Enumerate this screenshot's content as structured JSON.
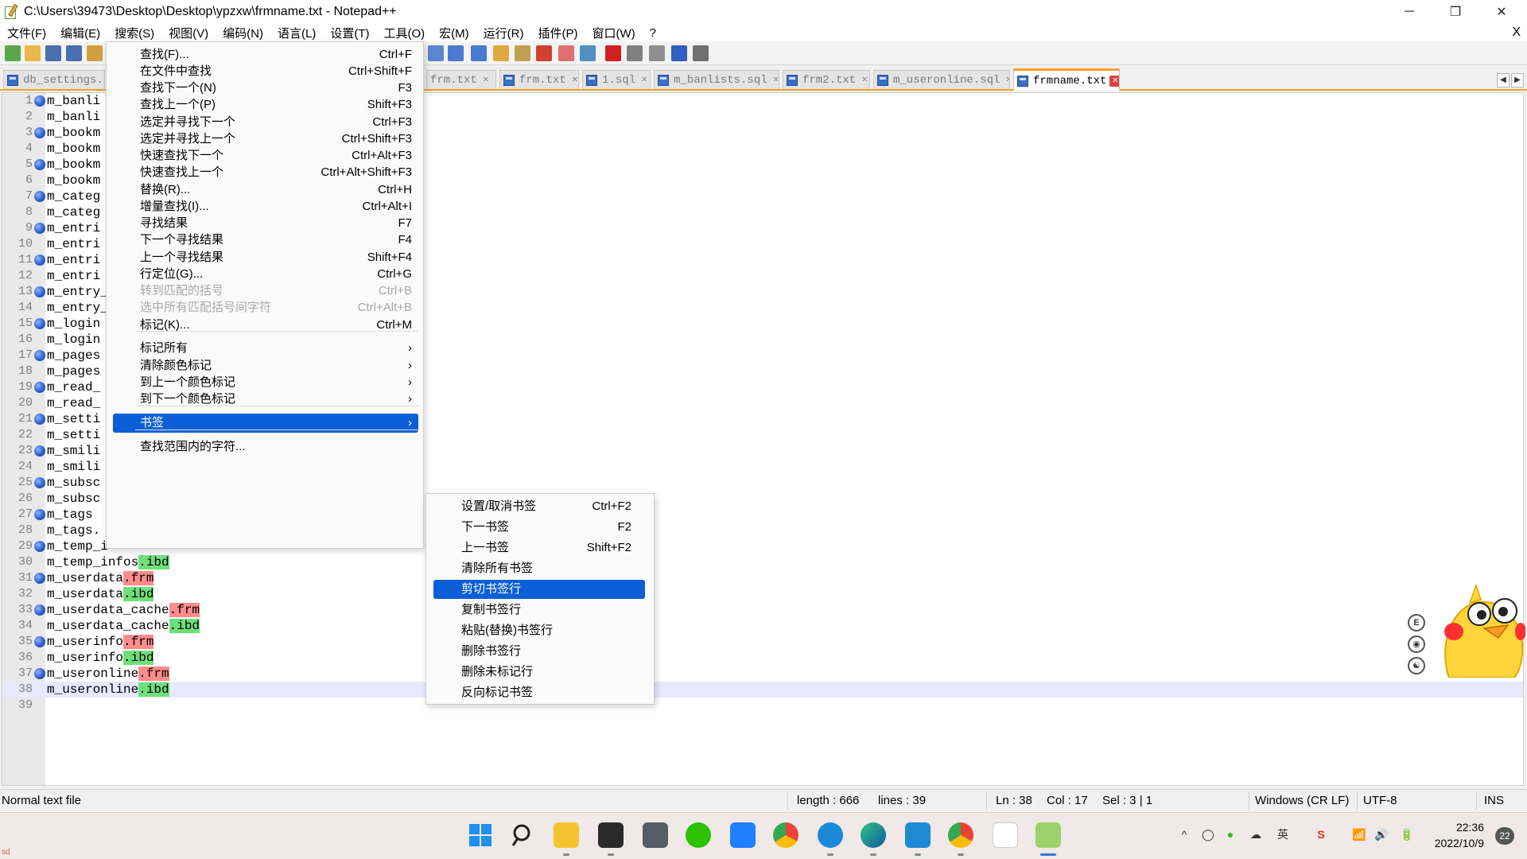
{
  "window": {
    "title": "C:\\Users\\39473\\Desktop\\Desktop\\ypzxw\\frmname.txt - Notepad++",
    "minimize": "─",
    "restore": "❐",
    "close": "✕"
  },
  "menubar": {
    "items": [
      "文件(F)",
      "编辑(E)",
      "搜索(S)",
      "视图(V)",
      "编码(N)",
      "语言(L)",
      "设置(T)",
      "工具(O)",
      "宏(M)",
      "运行(R)",
      "插件(P)",
      "窗口(W)",
      "?"
    ],
    "close_x": "X"
  },
  "tabs": [
    {
      "label": "db_settings.p"
    },
    {
      "label": "frm.txt"
    },
    {
      "label": "frm.txt"
    },
    {
      "label": "1.sql"
    },
    {
      "label": "m_banlists.sql"
    },
    {
      "label": "frm2.txt"
    },
    {
      "label": "m_useronline.sql"
    },
    {
      "label": "frmname.txt",
      "active": true
    }
  ],
  "tab_close_glyph": "✕",
  "tab_scroll": {
    "left": "◀",
    "right": "▶"
  },
  "editor": {
    "lines": [
      {
        "n": "1",
        "bm": true,
        "text": "m_banli"
      },
      {
        "n": "2",
        "bm": false,
        "text": "m_banli"
      },
      {
        "n": "3",
        "bm": true,
        "text": "m_bookm"
      },
      {
        "n": "4",
        "bm": false,
        "text": "m_bookm"
      },
      {
        "n": "5",
        "bm": true,
        "text": "m_bookm"
      },
      {
        "n": "6",
        "bm": false,
        "text": "m_bookm"
      },
      {
        "n": "7",
        "bm": true,
        "text": "m_categ"
      },
      {
        "n": "8",
        "bm": false,
        "text": "m_categ"
      },
      {
        "n": "9",
        "bm": true,
        "text": "m_entri"
      },
      {
        "n": "10",
        "bm": false,
        "text": "m_entri"
      },
      {
        "n": "11",
        "bm": true,
        "text": "m_entri"
      },
      {
        "n": "12",
        "bm": false,
        "text": "m_entri"
      },
      {
        "n": "13",
        "bm": true,
        "text": "m_entry_"
      },
      {
        "n": "14",
        "bm": false,
        "text": "m_entry_"
      },
      {
        "n": "15",
        "bm": true,
        "text": "m_login"
      },
      {
        "n": "16",
        "bm": false,
        "text": "m_login"
      },
      {
        "n": "17",
        "bm": true,
        "text": "m_pages"
      },
      {
        "n": "18",
        "bm": false,
        "text": "m_pages"
      },
      {
        "n": "19",
        "bm": true,
        "text": "m_read_"
      },
      {
        "n": "20",
        "bm": false,
        "text": "m_read_"
      },
      {
        "n": "21",
        "bm": true,
        "text": "m_setti"
      },
      {
        "n": "22",
        "bm": false,
        "text": "m_setti"
      },
      {
        "n": "23",
        "bm": true,
        "text": "m_smili"
      },
      {
        "n": "24",
        "bm": false,
        "text": "m_smili"
      },
      {
        "n": "25",
        "bm": true,
        "text": "m_subsc"
      },
      {
        "n": "26",
        "bm": false,
        "text": "m_subsc"
      },
      {
        "n": "27",
        "bm": true,
        "text": "m_tags"
      },
      {
        "n": "28",
        "bm": false,
        "text": "m_tags."
      },
      {
        "n": "29",
        "bm": true,
        "text": "m_temp_i"
      },
      {
        "n": "30",
        "bm": false,
        "text": "m_temp_infos",
        "ext": ".ibd",
        "kind": "ibd"
      },
      {
        "n": "31",
        "bm": true,
        "text": "m_userdata",
        "ext": ".frm",
        "kind": "frm"
      },
      {
        "n": "32",
        "bm": false,
        "text": "m_userdata",
        "ext": ".ibd",
        "kind": "ibd"
      },
      {
        "n": "33",
        "bm": true,
        "text": "m_userdata_cache",
        "ext": ".frm",
        "kind": "frm"
      },
      {
        "n": "34",
        "bm": false,
        "text": "m_userdata_cache",
        "ext": ".ibd",
        "kind": "ibd"
      },
      {
        "n": "35",
        "bm": true,
        "text": "m_userinfo",
        "ext": ".frm",
        "kind": "frm"
      },
      {
        "n": "36",
        "bm": false,
        "text": "m_userinfo",
        "ext": ".ibd",
        "kind": "ibd"
      },
      {
        "n": "37",
        "bm": true,
        "text": "m_useronline",
        "ext": ".frm",
        "kind": "frm"
      },
      {
        "n": "38",
        "bm": false,
        "text": "m_useronline",
        "ext": ".ibd",
        "kind": "ibd",
        "current": true
      },
      {
        "n": "39",
        "bm": false,
        "text": ""
      }
    ]
  },
  "search_menu": {
    "items": [
      {
        "label": "查找(F)...",
        "shortcut": "Ctrl+F"
      },
      {
        "label": "在文件中查找",
        "shortcut": "Ctrl+Shift+F"
      },
      {
        "label": "查找下一个(N)",
        "shortcut": "F3"
      },
      {
        "label": "查找上一个(P)",
        "shortcut": "Shift+F3"
      },
      {
        "label": "选定并寻找下一个",
        "shortcut": "Ctrl+F3"
      },
      {
        "label": "选定并寻找上一个",
        "shortcut": "Ctrl+Shift+F3"
      },
      {
        "label": "快速查找下一个",
        "shortcut": "Ctrl+Alt+F3"
      },
      {
        "label": "快速查找上一个",
        "shortcut": "Ctrl+Alt+Shift+F3"
      },
      {
        "label": "替换(R)...",
        "shortcut": "Ctrl+H"
      },
      {
        "label": "增量查找(I)...",
        "shortcut": "Ctrl+Alt+I"
      },
      {
        "label": "寻找结果",
        "shortcut": "F7"
      },
      {
        "label": "下一个寻找结果",
        "shortcut": "F4"
      },
      {
        "label": "上一个寻找结果",
        "shortcut": "Shift+F4"
      },
      {
        "label": "行定位(G)...",
        "shortcut": "Ctrl+G"
      },
      {
        "label": "转到匹配的括号",
        "shortcut": "Ctrl+B",
        "disabled": true
      },
      {
        "label": "选中所有匹配括号间字符",
        "shortcut": "Ctrl+Alt+B",
        "disabled": true
      },
      {
        "label": "标记(K)...",
        "shortcut": "Ctrl+M"
      },
      {
        "label": "标记所有",
        "submenu": true
      },
      {
        "label": "清除颜色标记",
        "submenu": true
      },
      {
        "label": "到上一个颜色标记",
        "submenu": true
      },
      {
        "label": "到下一个颜色标记",
        "submenu": true
      },
      {
        "label": "书签",
        "submenu": true,
        "selected": true
      },
      {
        "label": "查找范围内的字符..."
      }
    ],
    "submenu_arrow": "›"
  },
  "bookmark_menu": {
    "items": [
      {
        "label": "设置/取消书签",
        "shortcut": "Ctrl+F2"
      },
      {
        "label": "下一书签",
        "shortcut": "F2"
      },
      {
        "label": "上一书签",
        "shortcut": "Shift+F2"
      },
      {
        "label": "清除所有书签",
        "shortcut": ""
      },
      {
        "label": "剪切书签行",
        "shortcut": "",
        "selected": true
      },
      {
        "label": "复制书签行",
        "shortcut": ""
      },
      {
        "label": "粘贴(替换)书签行",
        "shortcut": ""
      },
      {
        "label": "删除书签行",
        "shortcut": ""
      },
      {
        "label": "删除未标记行",
        "shortcut": ""
      },
      {
        "label": "反向标记书签",
        "shortcut": ""
      }
    ]
  },
  "side_icons": [
    "E",
    "◉",
    "☯"
  ],
  "statusbar": {
    "file_type": "Normal text file",
    "length": "length : 666",
    "lines": "lines : 39",
    "ln": "Ln : 38",
    "col": "Col : 17",
    "sel": "Sel : 3 | 1",
    "eol": "Windows (CR LF)",
    "encoding": "UTF-8",
    "mode": "INS"
  },
  "taskbar": {
    "tray": [
      "^",
      "◯",
      "●",
      "☁",
      "英",
      "S",
      "📶",
      "🔊",
      "🔋"
    ],
    "time": "22:36",
    "date": "2022/10/9",
    "notifications": "22"
  },
  "corner_label": "sd",
  "colors": {
    "accent": "#0a5fd6",
    "tab_active": "#ff9e28",
    "frm_highlight": "#ff8c8c",
    "ibd_highlight": "#6ee07a"
  }
}
